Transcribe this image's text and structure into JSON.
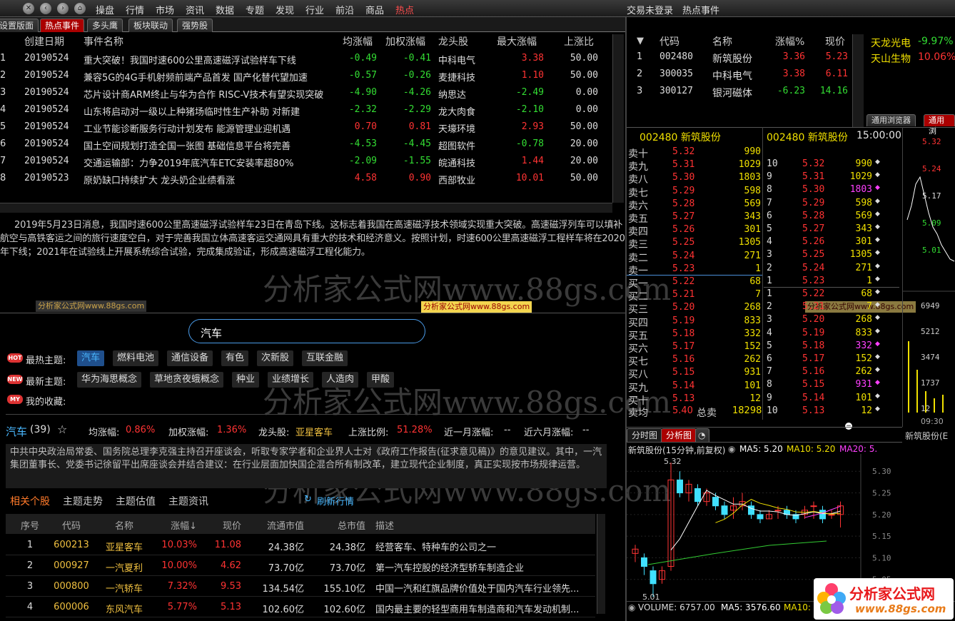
{
  "menu": {
    "items": [
      "操盘",
      "行情",
      "市场",
      "资讯",
      "数据",
      "专题",
      "发现",
      "行业",
      "前沿",
      "商品",
      "热点"
    ],
    "active": "热点",
    "login": "交易未登录",
    "right_title": "热点事件"
  },
  "tabs": [
    "设置版面",
    "热点事件",
    "多头鹰",
    "板块联动",
    "强势股"
  ],
  "events": {
    "headers": [
      "创建日期",
      "事件名称",
      "均涨幅",
      "加权涨幅",
      "龙头股",
      "最大涨幅",
      "上涨比"
    ],
    "rows": [
      [
        "1",
        "20190524",
        "重大突破！我国时速600公里高速磁浮试验样车下线",
        "-0.49",
        "-0.41",
        "中科电气",
        "3.38",
        "50.00"
      ],
      [
        "2",
        "20190524",
        "兼容5G的4G手机射频前端产品首发 国产化替代望加速",
        "-0.57",
        "-0.26",
        "麦捷科技",
        "1.10",
        "50.00"
      ],
      [
        "3",
        "20190524",
        "芯片设计商ARM终止与华为合作 RISC-V技术有望实现突破",
        "-4.90",
        "-4.26",
        "纳思达",
        "-2.49",
        "0.00"
      ],
      [
        "4",
        "20190524",
        "山东将启动对一级以上种猪场临时性生产补助 对新建",
        "-2.32",
        "-2.29",
        "龙大肉食",
        "-2.10",
        "0.00"
      ],
      [
        "5",
        "20190524",
        "工业节能诊断服务行动计划发布 能源管理业迎机遇",
        "0.70",
        "0.81",
        "天壕环境",
        "2.93",
        "50.00"
      ],
      [
        "6",
        "20190524",
        "国土空间规划打造全国一张图 基础信息平台将完善",
        "-4.53",
        "-4.45",
        "超图软件",
        "-0.78",
        "20.00"
      ],
      [
        "7",
        "20190524",
        "交通运输部：力争2019年底汽车ETC安装率超80%",
        "-2.09",
        "-1.55",
        "皖通科技",
        "1.44",
        "20.00"
      ],
      [
        "8",
        "20190523",
        "原奶缺口持续扩大 龙头奶企业绩看涨",
        "4.58",
        "0.90",
        "西部牧业",
        "10.01",
        "50.00"
      ]
    ]
  },
  "news_text": "2019年5月23日消息，我国时速600公里高速磁浮试验样车23日在青岛下线。这标志着我国在高速磁浮技术领域实现重大突破。高速磁浮列车可以填补航空与高铁客运之间的旅行速度空白，对于完善我国立体高速客运交通网具有重大的技术和经济意义。按照计划，时速600公里高速磁浮工程样车将在2020年下线；2021年在试验线上开展系统综合试验，完成集成验证，形成高速磁浮工程化能力。",
  "watermarks": {
    "big": "分析家公式网www.88gs.com",
    "small": "分析家公式网www.88gs.com"
  },
  "search": {
    "value": "汽车"
  },
  "topics": {
    "hot_label": "最热主题:",
    "hot": [
      "汽车",
      "燃料电池",
      "通信设备",
      "有色",
      "次新股",
      "互联金融"
    ],
    "new_label": "最新主题:",
    "new": [
      "华为海思概念",
      "草地贪夜蛾概念",
      "种业",
      "业绩增长",
      "人造肉",
      "甲酸"
    ],
    "fav_label": "我的收藏:",
    "badges": [
      "HOT",
      "NEW",
      "MY"
    ]
  },
  "theme": {
    "name": "汽车",
    "count": "(39)",
    "star": "☆",
    "avg_label": "均涨幅:",
    "avg": "0.86%",
    "wavg_label": "加权涨幅:",
    "wavg": "1.36%",
    "lead_label": "龙头股:",
    "lead": "亚星客车",
    "up_label": "上涨比例:",
    "up": "51.28%",
    "m1_label": "近一月涨幅:",
    "m1": "--",
    "m6_label": "近六月涨幅:",
    "m6": "--",
    "desc": "中共中央政治局常委、国务院总理李克强主持召开座谈会，听取专家学者和企业界人士对《政府工作报告(征求意见稿)》的意见建议。其中，一汽集团董事长、党委书记徐留平出席座谈会并结合建议：在行业层面加快国企混合所有制改革，建立现代企业制度，真正实现按市场规律运营。"
  },
  "subtabs": [
    "相关个股",
    "主题走势",
    "主题估值",
    "主题资讯"
  ],
  "refresh": "刷新行情",
  "stocks": {
    "headers": [
      "序号",
      "代码",
      "名称",
      "涨幅↓",
      "现价",
      "流通市值",
      "总市值",
      "描述"
    ],
    "rows": [
      [
        "1",
        "600213",
        "亚星客车",
        "10.03%",
        "11.08",
        "24.38亿",
        "24.38亿",
        "经营客车、特种车的公司之一"
      ],
      [
        "2",
        "000927",
        "一汽夏利",
        "10.00%",
        "4.62",
        "73.70亿",
        "73.70亿",
        "第一汽车控股的经济型轿车制造企业"
      ],
      [
        "3",
        "000800",
        "一汽轿车",
        "7.32%",
        "9.53",
        "134.54亿",
        "155.10亿",
        "中国一汽和红旗品牌价值处于国内汽车行业领先..."
      ],
      [
        "4",
        "600006",
        "东风汽车",
        "5.77%",
        "5.13",
        "102.60亿",
        "102.60亿",
        "国内最主要的轻型商用车制造商和汽车发动机制..."
      ]
    ]
  },
  "related": {
    "headers": [
      "代码",
      "名称",
      "涨幅%",
      "现价"
    ],
    "rows": [
      [
        "1",
        "002480",
        "新筑股份",
        "3.36",
        "5.23"
      ],
      [
        "2",
        "300035",
        "中科电气",
        "3.38",
        "6.11"
      ],
      [
        "3",
        "300127",
        "银河磁体",
        "-6.23",
        "14.16"
      ]
    ]
  },
  "sideticker": [
    [
      "天龙光电",
      "-9.97%"
    ],
    [
      "天山生物",
      "10.06%"
    ]
  ],
  "browser_tabs": [
    "通用浏览器",
    "通用浏"
  ],
  "orderbook": {
    "title": "002480 新筑股份",
    "rows": [
      [
        "卖十",
        "5.32",
        "990"
      ],
      [
        "卖九",
        "5.31",
        "1029"
      ],
      [
        "卖八",
        "5.30",
        "1803"
      ],
      [
        "卖七",
        "5.29",
        "598"
      ],
      [
        "卖六",
        "5.28",
        "569"
      ],
      [
        "卖五",
        "5.27",
        "343"
      ],
      [
        "卖四",
        "5.26",
        "301"
      ],
      [
        "卖三",
        "5.25",
        "1305"
      ],
      [
        "卖二",
        "5.24",
        "271"
      ],
      [
        "卖一",
        "5.23",
        "1"
      ],
      [
        "买一",
        "5.22",
        "68"
      ],
      [
        "买二",
        "5.21",
        "7"
      ],
      [
        "买三",
        "5.20",
        "268"
      ],
      [
        "买四",
        "5.19",
        "833"
      ],
      [
        "买五",
        "5.18",
        "332"
      ],
      [
        "买六",
        "5.17",
        "152"
      ],
      [
        "买七",
        "5.16",
        "262"
      ],
      [
        "买八",
        "5.15",
        "931"
      ],
      [
        "买九",
        "5.14",
        "101"
      ],
      [
        "买十",
        "5.13",
        "12"
      ]
    ],
    "avg_label": "卖均",
    "avg": "5.40",
    "total_label": "总卖",
    "total": "18298"
  },
  "depth": {
    "title": "002480 新筑股份",
    "time": "15:00:00",
    "rows": [
      [
        "10",
        "5.32",
        "990"
      ],
      [
        "9",
        "5.31",
        "1029"
      ],
      [
        "8",
        "5.30",
        "1803"
      ],
      [
        "7",
        "5.29",
        "598"
      ],
      [
        "6",
        "5.28",
        "569"
      ],
      [
        "5",
        "5.27",
        "343"
      ],
      [
        "4",
        "5.26",
        "301"
      ],
      [
        "3",
        "5.25",
        "1305"
      ],
      [
        "2",
        "5.24",
        "271"
      ],
      [
        "1",
        "5.23",
        "1"
      ],
      [
        "1",
        "5.22",
        "68"
      ],
      [
        "2",
        "5.21",
        "7"
      ],
      [
        "3",
        "5.20",
        "268"
      ],
      [
        "4",
        "5.19",
        "833"
      ],
      [
        "5",
        "5.18",
        "332"
      ],
      [
        "6",
        "5.17",
        "152"
      ],
      [
        "7",
        "5.16",
        "262"
      ],
      [
        "8",
        "5.15",
        "931"
      ],
      [
        "9",
        "5.14",
        "101"
      ],
      [
        "10",
        "5.13",
        "12"
      ]
    ]
  },
  "minichart": {
    "prices": [
      "5.32",
      "5.24",
      "5.17",
      "5.09",
      "5.01"
    ],
    "vols": [
      "6949",
      "5212",
      "3474",
      "1737",
      "12"
    ],
    "time": "09:30",
    "name": "新筑股份(E"
  },
  "chart_tabs": [
    "分时图",
    "分析图"
  ],
  "kline_header": {
    "name": "新筑股份(15分钟,前复权)",
    "ma5": "MA5: 5.20",
    "ma10": "MA10: 5.20",
    "ma20": "MA20: 5."
  },
  "kline_annot": {
    "high": "5.32",
    "low": "5.01"
  },
  "volume_bar": {
    "label": "VOLUME: 6757.00",
    "ma5": "MA5: 3576.60",
    "ma10": "MA10: 27"
  },
  "logo": {
    "cn": "分析家公式网",
    "url": "www.88gs.com"
  },
  "chart_data": {
    "type": "candlestick",
    "ylim": [
      5.01,
      5.32
    ],
    "yticks": [
      "5.30",
      "5.25",
      "5.20",
      "5.15",
      "5.10",
      "5.05"
    ],
    "candles": [
      [
        5.11,
        5.12,
        5.09,
        5.13
      ],
      [
        5.1,
        5.08,
        5.06,
        5.11
      ],
      [
        5.07,
        5.04,
        5.01,
        5.08
      ],
      [
        5.05,
        5.07,
        5.04,
        5.08
      ],
      [
        5.08,
        5.28,
        5.07,
        5.32
      ],
      [
        5.28,
        5.25,
        5.24,
        5.3
      ],
      [
        5.25,
        5.27,
        5.23,
        5.28
      ],
      [
        5.26,
        5.23,
        5.22,
        5.27
      ],
      [
        5.23,
        5.25,
        5.22,
        5.26
      ],
      [
        5.24,
        5.22,
        5.21,
        5.25
      ],
      [
        5.22,
        5.2,
        5.19,
        5.23
      ],
      [
        5.21,
        5.22,
        5.19,
        5.24
      ],
      [
        5.22,
        5.23,
        5.21,
        5.25
      ],
      [
        5.22,
        5.2,
        5.19,
        5.23
      ],
      [
        5.2,
        5.19,
        5.18,
        5.21
      ],
      [
        5.19,
        5.2,
        5.19,
        5.21
      ],
      [
        5.21,
        5.21,
        5.19,
        5.22
      ],
      [
        5.21,
        5.2,
        5.19,
        5.22
      ],
      [
        5.2,
        5.19,
        5.18,
        5.21
      ],
      [
        5.2,
        5.21,
        5.19,
        5.22
      ],
      [
        5.22,
        5.22,
        5.19,
        5.23
      ],
      [
        5.21,
        5.19,
        5.18,
        5.22
      ],
      [
        5.2,
        5.2,
        5.19,
        5.21
      ],
      [
        5.2,
        5.22,
        5.17,
        5.23
      ]
    ]
  }
}
